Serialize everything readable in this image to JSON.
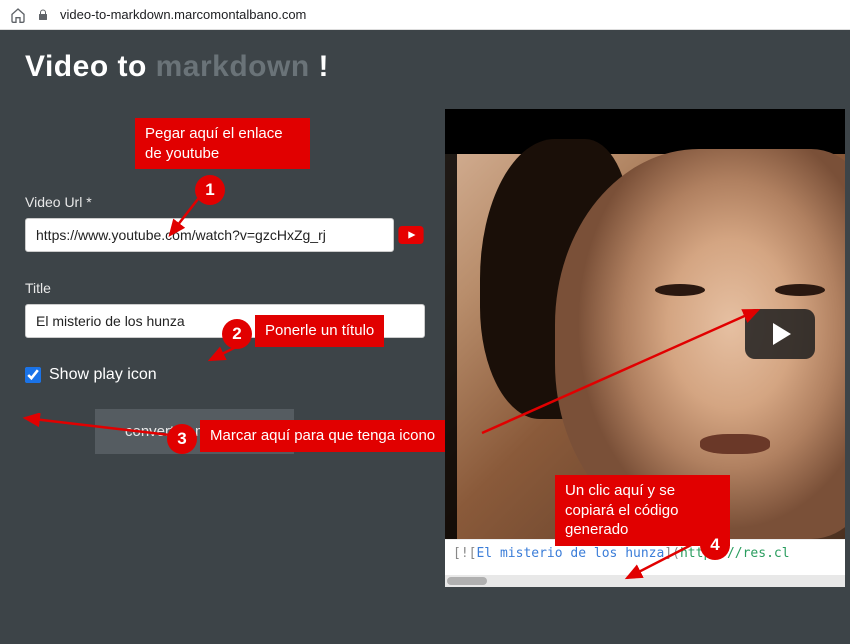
{
  "browser": {
    "url": "video-to-markdown.marcomontalbano.com"
  },
  "page": {
    "title_prefix": "Video to ",
    "title_highlight": "markdown",
    "title_suffix": " !"
  },
  "form": {
    "video_url_label": "Video Url *",
    "video_url_value": "https://www.youtube.com/watch?v=gzcHxZg_rj",
    "title_label": "Title",
    "title_value": "El misterio de los hunza",
    "show_play_label": "Show play icon",
    "show_play_checked": true,
    "convert_button": "convert to markdown"
  },
  "output": {
    "code_bracket_open": "[![",
    "code_title": "El misterio de los hunza",
    "code_mid": "](",
    "code_url": "https://res.cl",
    "code_close": ""
  },
  "annotations": {
    "a1_text": "Pegar aquí el enlace de youtube",
    "a1_num": "1",
    "a2_text": "Ponerle un  título",
    "a2_num": "2",
    "a3_text": "Marcar aquí para que tenga icono",
    "a3_num": "3",
    "a4_text": "Un clic aquí y se copiará el código generado",
    "a4_num": "4"
  }
}
